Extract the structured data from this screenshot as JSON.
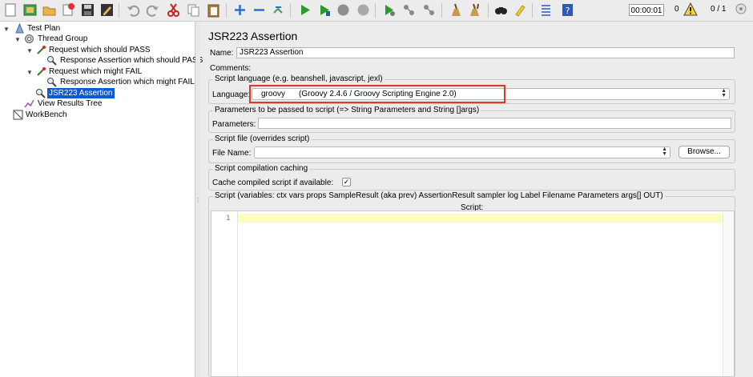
{
  "toolbar": {
    "buttons": [
      "new-icon",
      "templates-icon",
      "open-icon",
      "close-icon",
      "save-icon",
      "save-as-icon",
      "undo-icon",
      "redo-icon",
      "cut-icon",
      "copy-icon",
      "paste-icon",
      "expand-icon",
      "collapse-icon",
      "toggle-icon",
      "start-icon",
      "start-no-pauses-icon",
      "stop-icon",
      "shutdown-icon",
      "remote-start-icon",
      "remote-stop-icon",
      "remote-shutdown-icon",
      "clear-icon",
      "clear-all-icon",
      "search-icon",
      "reset-search-icon",
      "function-helper-icon",
      "help-icon"
    ],
    "timer": "00:00:01",
    "error_count": "0",
    "threads": "0 / 1"
  },
  "tree": {
    "items": [
      {
        "label": "Test Plan"
      },
      {
        "label": "Thread Group"
      },
      {
        "label": "Request which should PASS"
      },
      {
        "label": "Response Assertion which should PASS"
      },
      {
        "label": "Request which might FAIL"
      },
      {
        "label": "Response Assertion which might FAIL"
      },
      {
        "label": "JSR223 Assertion"
      },
      {
        "label": "View Results Tree"
      },
      {
        "label": "WorkBench"
      }
    ],
    "selected": "JSR223 Assertion"
  },
  "panel": {
    "title": "JSR223 Assertion",
    "name_label": "Name:",
    "name_value": "JSR223 Assertion",
    "comments_label": "Comments:",
    "script_language_group": "Script language (e.g. beanshell, javascript, jexl)",
    "language_label": "Language:",
    "language_value": "groovy",
    "language_engine": "(Groovy 2.4.6 / Groovy Scripting Engine 2.0)",
    "params_group": "Parameters to be passed to script (=> String Parameters and String []args)",
    "params_label": "Parameters:",
    "params_value": "",
    "script_file_group": "Script file (overrides script)",
    "file_name_label": "File Name:",
    "file_name_value": "",
    "browse_label": "Browse...",
    "caching_group": "Script compilation caching",
    "cache_label": "Cache compiled script if available:",
    "cache_checked": "✓",
    "script_group": "Script (variables: ctx vars props SampleResult (aka prev) AssertionResult sampler log Label Filename Parameters args[] OUT)",
    "script_label": "Script:",
    "line_number": "1",
    "highlight_color": "#d93a2b"
  }
}
